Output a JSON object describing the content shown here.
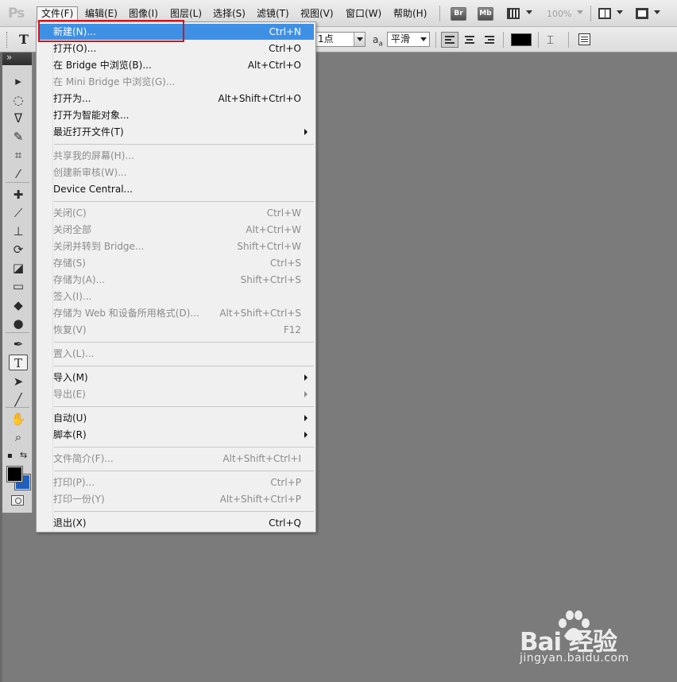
{
  "app": {
    "logo": "Ps",
    "zoom": "100%"
  },
  "menubar": {
    "items": [
      {
        "id": "file",
        "label": "文件(F)"
      },
      {
        "id": "edit",
        "label": "编辑(E)"
      },
      {
        "id": "image",
        "label": "图像(I)"
      },
      {
        "id": "layer",
        "label": "图层(L)"
      },
      {
        "id": "select",
        "label": "选择(S)"
      },
      {
        "id": "filter",
        "label": "滤镜(T)"
      },
      {
        "id": "view",
        "label": "视图(V)"
      },
      {
        "id": "window",
        "label": "窗口(W)"
      },
      {
        "id": "help",
        "label": "帮助(H)"
      }
    ],
    "bridge_button": "Br",
    "minibridge_button": "Mb"
  },
  "options_bar": {
    "tool_letter": "T",
    "font_size": "1点",
    "aa_icon": "a",
    "aa_icon_sub": "a",
    "antialias": "平滑",
    "text_color": "#000000"
  },
  "file_menu": {
    "items": [
      {
        "label": "新建(N)...",
        "shortcut": "Ctrl+N",
        "state": "highlight"
      },
      {
        "label": "打开(O)...",
        "shortcut": "Ctrl+O",
        "state": "enabled"
      },
      {
        "label": "在 Bridge 中浏览(B)...",
        "shortcut": "Alt+Ctrl+O",
        "state": "enabled"
      },
      {
        "label": "在 Mini Bridge 中浏览(G)...",
        "shortcut": "",
        "state": "disabled"
      },
      {
        "label": "打开为...",
        "shortcut": "Alt+Shift+Ctrl+O",
        "state": "enabled"
      },
      {
        "label": "打开为智能对象...",
        "shortcut": "",
        "state": "enabled"
      },
      {
        "label": "最近打开文件(T)",
        "shortcut": "",
        "state": "enabled",
        "submenu": true
      },
      {
        "separator": true
      },
      {
        "label": "共享我的屏幕(H)...",
        "shortcut": "",
        "state": "disabled"
      },
      {
        "label": "创建新审核(W)...",
        "shortcut": "",
        "state": "disabled"
      },
      {
        "label": "Device Central...",
        "shortcut": "",
        "state": "enabled"
      },
      {
        "separator": true
      },
      {
        "label": "关闭(C)",
        "shortcut": "Ctrl+W",
        "state": "disabled"
      },
      {
        "label": "关闭全部",
        "shortcut": "Alt+Ctrl+W",
        "state": "disabled"
      },
      {
        "label": "关闭并转到 Bridge...",
        "shortcut": "Shift+Ctrl+W",
        "state": "disabled"
      },
      {
        "label": "存储(S)",
        "shortcut": "Ctrl+S",
        "state": "disabled"
      },
      {
        "label": "存储为(A)...",
        "shortcut": "Shift+Ctrl+S",
        "state": "disabled"
      },
      {
        "label": "签入(I)...",
        "shortcut": "",
        "state": "disabled"
      },
      {
        "label": "存储为 Web 和设备所用格式(D)...",
        "shortcut": "Alt+Shift+Ctrl+S",
        "state": "disabled"
      },
      {
        "label": "恢复(V)",
        "shortcut": "F12",
        "state": "disabled"
      },
      {
        "separator": true
      },
      {
        "label": "置入(L)...",
        "shortcut": "",
        "state": "disabled"
      },
      {
        "separator": true
      },
      {
        "label": "导入(M)",
        "shortcut": "",
        "state": "enabled",
        "submenu": true
      },
      {
        "label": "导出(E)",
        "shortcut": "",
        "state": "disabled",
        "submenu": true
      },
      {
        "separator": true
      },
      {
        "label": "自动(U)",
        "shortcut": "",
        "state": "enabled",
        "submenu": true
      },
      {
        "label": "脚本(R)",
        "shortcut": "",
        "state": "enabled",
        "submenu": true
      },
      {
        "separator": true
      },
      {
        "label": "文件简介(F)...",
        "shortcut": "Alt+Shift+Ctrl+I",
        "state": "disabled"
      },
      {
        "separator": true
      },
      {
        "label": "打印(P)...",
        "shortcut": "Ctrl+P",
        "state": "disabled"
      },
      {
        "label": "打印一份(Y)",
        "shortcut": "Alt+Shift+Ctrl+P",
        "state": "disabled"
      },
      {
        "separator": true
      },
      {
        "label": "退出(X)",
        "shortcut": "Ctrl+Q",
        "state": "enabled"
      }
    ]
  },
  "toolbox": {
    "tools": [
      {
        "name": "move-tool-icon",
        "glyph": "▸"
      },
      {
        "name": "marquee-tool-icon",
        "glyph": "◌"
      },
      {
        "name": "lasso-tool-icon",
        "glyph": "ᐁ"
      },
      {
        "name": "quick-select-tool-icon",
        "glyph": "✎"
      },
      {
        "name": "crop-tool-icon",
        "glyph": "⌗"
      },
      {
        "name": "eyedropper-tool-icon",
        "glyph": "⁄"
      },
      {
        "name": "healing-brush-tool-icon",
        "glyph": "✚"
      },
      {
        "name": "brush-tool-icon",
        "glyph": "⟋"
      },
      {
        "name": "clone-stamp-tool-icon",
        "glyph": "⊥"
      },
      {
        "name": "history-brush-tool-icon",
        "glyph": "⟳"
      },
      {
        "name": "eraser-tool-icon",
        "glyph": "◪"
      },
      {
        "name": "gradient-tool-icon",
        "glyph": "▭"
      },
      {
        "name": "blur-tool-icon",
        "glyph": "◆"
      },
      {
        "name": "dodge-tool-icon",
        "glyph": "●"
      },
      {
        "name": "pen-tool-icon",
        "glyph": "✒"
      },
      {
        "name": "type-tool-icon",
        "glyph": "T"
      },
      {
        "name": "path-select-tool-icon",
        "glyph": "➤"
      },
      {
        "name": "line-tool-icon",
        "glyph": "╱"
      },
      {
        "name": "hand-tool-icon",
        "glyph": "✋"
      },
      {
        "name": "zoom-tool-icon",
        "glyph": "⌕"
      }
    ],
    "swap_colors_icon": "⇆",
    "default_colors_icon": "▪",
    "foreground_color": "#000000",
    "background_color": "#1f5fbf"
  },
  "watermark": {
    "brand": "Bai  经验",
    "url": "jingyan.baidu.com"
  },
  "colors": {
    "menu_highlight": "#3e90e4",
    "annotation_box": "#d4141b",
    "workspace": "#7b7b7b"
  }
}
